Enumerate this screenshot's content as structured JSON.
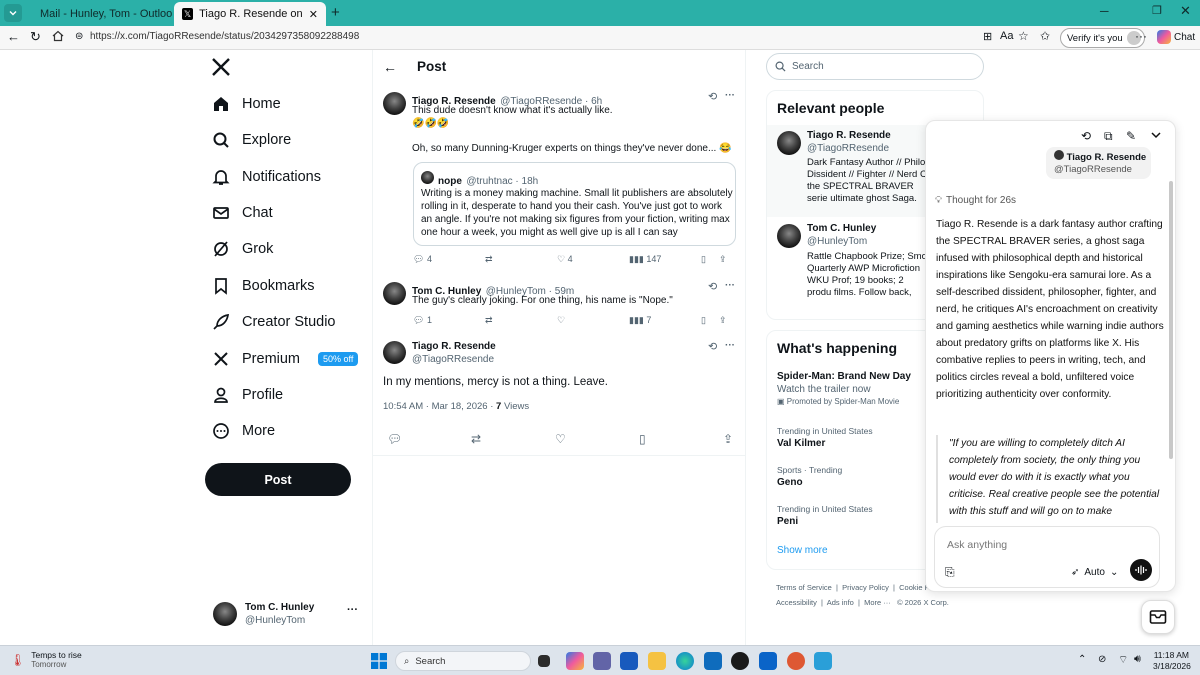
{
  "browser": {
    "tabs": [
      {
        "label": "Mail - Hunley, Tom - Outlook"
      },
      {
        "label": "Tiago R. Resende on X: \"@Hunley"
      }
    ],
    "url": "https://x.com/TiagoRResende/status/2034297358092288498",
    "verify_label": "Verify it's you",
    "chat_label": "Chat"
  },
  "sidebar": {
    "items": [
      {
        "label": "Home",
        "icon": "home-icon"
      },
      {
        "label": "Explore",
        "icon": "search-icon"
      },
      {
        "label": "Notifications",
        "icon": "bell-icon"
      },
      {
        "label": "Chat",
        "icon": "mail-icon"
      },
      {
        "label": "Grok",
        "icon": "grok-icon"
      },
      {
        "label": "Bookmarks",
        "icon": "bookmark-icon"
      },
      {
        "label": "Creator Studio",
        "icon": "rocket-icon"
      },
      {
        "label": "Premium",
        "icon": "x-logo-icon",
        "badge": "50% off"
      },
      {
        "label": "Profile",
        "icon": "person-icon"
      },
      {
        "label": "More",
        "icon": "more-circle-icon"
      }
    ],
    "post_label": "Post",
    "account": {
      "name": "Tom C. Hunley",
      "handle": "@HunleyTom"
    }
  },
  "main": {
    "header_title": "Post",
    "tweet1": {
      "name": "Tiago R. Resende",
      "handle_time": "@TiagoRResende · 6h",
      "line1": "This dude doesn't know what it's actually like.",
      "line2": "🤣🤣🤣",
      "line3": "Oh, so many Dunning-Kruger experts on things they've never done... 😂",
      "quote": {
        "name": "nope",
        "handle_time": "@truhtnac · 18h",
        "text": "Writing is a money making machine. Small lit publishers are absolutely rolling in it, desperate to hand you their cash. You've just got to work an angle. If you're not making six figures from your fiction, writing max one hour a week, you might as well give up is all I can say"
      },
      "replies": "4",
      "likes": "4",
      "views": "147"
    },
    "tweet2": {
      "name": "Tom C. Hunley",
      "handle_time": "@HunleyTom · 59m",
      "text": "The guy's clearly joking. For one thing, his name is \"Nope.\"",
      "replies": "1",
      "views": "7"
    },
    "main_tweet": {
      "name": "Tiago R. Resende",
      "handle": "@TiagoRResende",
      "text": "In my mentions, mercy is not a thing. Leave.",
      "timestamp": "10:54 AM · Mar 18, 2026 · ",
      "views_count": "7",
      "views_label": " Views"
    }
  },
  "right": {
    "search_placeholder": "Search",
    "relevant_title": "Relevant people",
    "people": [
      {
        "name": "Tiago R. Resende",
        "handle": "@TiagoRResende",
        "bio": "Dark Fantasy Author // Philo Dissident // Fighter // Nerd C the SPECTRAL BRAVER serie ultimate ghost Saga. Start b"
      },
      {
        "name": "Tom C. Hunley",
        "handle": "@HunleyTom",
        "bio": "Rattle Chapbook Prize; Smo Quarterly AWP Microfiction WKU Prof; 19 books; 2 produ films. Follow back, please. I ALL SOLICITORS."
      }
    ],
    "happening_title": "What's happening",
    "trends": [
      {
        "meta": "",
        "title": "Spider-Man: Brand New Day",
        "sub": "Watch the trailer now",
        "promo": "Promoted by Spider-Man Movie"
      },
      {
        "meta": "Trending in United States",
        "title": "Val Kilmer"
      },
      {
        "meta": "Sports · Trending",
        "title": "Geno"
      },
      {
        "meta": "Trending in United States",
        "title": "Peni"
      }
    ],
    "show_more": "Show more",
    "footer1": [
      "Terms of Service",
      "Privacy Policy",
      "Cookie P"
    ],
    "footer2": [
      "Accessibility",
      "Ads info",
      "More ···",
      "© 2026 X Corp."
    ]
  },
  "grok": {
    "user_bubble": {
      "name": "Tiago R. Resende",
      "handle": "@TiagoRResende"
    },
    "thought": "Thought for 26s",
    "answer": "Tiago R. Resende is a dark fantasy author crafting the SPECTRAL BRAVER series, a ghost saga infused with philosophical depth and historical inspirations like Sengoku-era samurai lore. As a self-described dissident, philosopher, fighter, and nerd, he critiques AI's encroachment on creativity and gaming aesthetics while warning indie authors about predatory grifts on platforms like X. His combative replies to peers in writing, tech, and politics circles reveal a bold, unfiltered voice prioritizing authenticity over conformity.",
    "quote": "\"If you are willing to completely ditch AI completely from society, the only thing you would ever do with it is exactly what you criticise. Real creative people see the potential with this stuff and will go on to make",
    "input_placeholder": "Ask anything",
    "mode": "Auto"
  },
  "taskbar": {
    "weather_title": "Temps to rise",
    "weather_sub": "Tomorrow",
    "search": "Search",
    "time": "11:18 AM",
    "date": "3/18/2026"
  }
}
